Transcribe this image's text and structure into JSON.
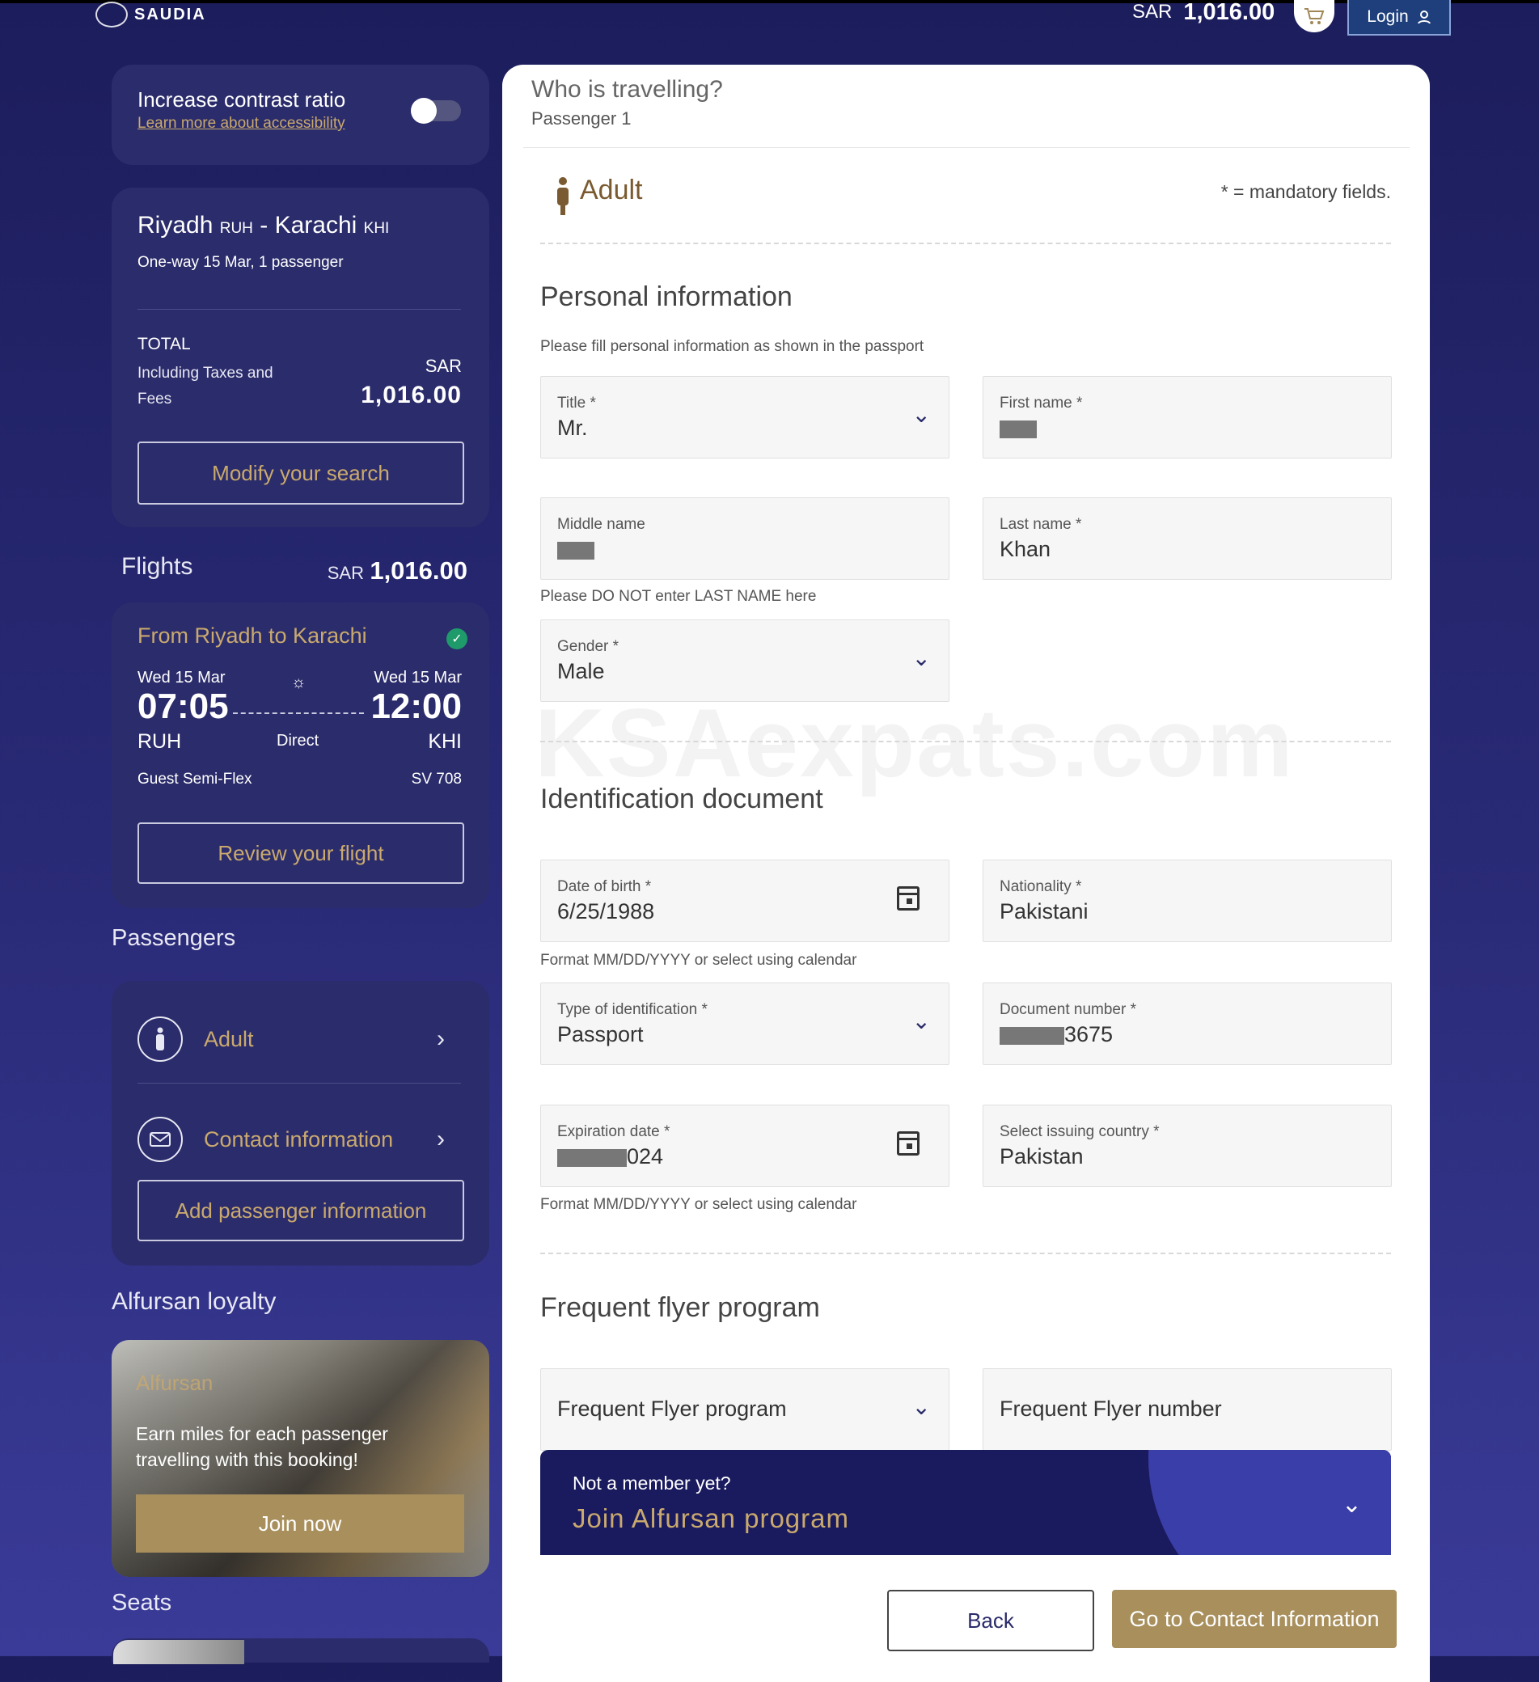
{
  "header": {
    "brand": "SAUDIA",
    "currency": "SAR",
    "total": "1,016.00",
    "cart_icon": "cart-icon",
    "login_label": "Login",
    "login_icon": "user-icon"
  },
  "accessibility": {
    "title": "Increase contrast ratio",
    "link": "Learn more about accessibility",
    "toggle_on": false
  },
  "trip": {
    "origin_city": "Riyadh",
    "origin_code": "RUH",
    "separator": "-",
    "dest_city": "Karachi",
    "dest_code": "KHI",
    "details": "One-way 15 Mar, 1 passenger",
    "total_label": "TOTAL",
    "total_sub": "Including Taxes and Fees",
    "currency": "SAR",
    "total_amount": "1,016.00",
    "modify_label": "Modify your search"
  },
  "flights": {
    "label": "Flights",
    "currency": "SAR",
    "amount": "1,016.00",
    "segment": {
      "title": "From Riyadh to Karachi",
      "dep_date": "Wed 15 Mar",
      "arr_date": "Wed 15 Mar",
      "dep_time": "07:05",
      "arr_time": "12:00",
      "dep_code": "RUH",
      "arr_code": "KHI",
      "stops": "Direct",
      "fare": "Guest Semi-Flex",
      "flight_no": "SV 708",
      "review_label": "Review your flight"
    }
  },
  "passengers": {
    "heading": "Passengers",
    "items": [
      {
        "label": "Adult",
        "icon": "person-icon"
      },
      {
        "label": "Contact information",
        "icon": "envelope-icon"
      }
    ],
    "add_label": "Add passenger information"
  },
  "loyalty": {
    "heading": "Alfursan loyalty",
    "brand": "Alfursan",
    "message": "Earn miles for each passenger travelling with this booking!",
    "join_label": "Join now"
  },
  "seats": {
    "heading": "Seats"
  },
  "form": {
    "title": "Who is travelling?",
    "passenger": "Passenger 1",
    "pax_type": "Adult",
    "mandatory_note": "* = mandatory fields.",
    "personal": {
      "heading": "Personal information",
      "hint": "Please fill personal information as shown in the passport",
      "title_label": "Title *",
      "title_value": "Mr.",
      "first_label": "First name *",
      "middle_label": "Middle name",
      "middle_hint": "Please DO NOT enter LAST NAME here",
      "last_label": "Last name *",
      "last_value": "Khan",
      "gender_label": "Gender *",
      "gender_value": "Male"
    },
    "watermark": "KSAexpats.com",
    "identification": {
      "heading": "Identification document",
      "dob_label": "Date of birth *",
      "dob_value": "6/25/1988",
      "dob_hint": "Format MM/DD/YYYY or select using calendar",
      "nationality_label": "Nationality *",
      "nationality_value": "Pakistani",
      "type_label": "Type of identification *",
      "type_value": "Passport",
      "docnum_label": "Document number *",
      "docnum_suffix": "3675",
      "exp_label": "Expiration date *",
      "exp_suffix": "024",
      "exp_hint": "Format MM/DD/YYYY or select using calendar",
      "country_label": "Select issuing country *",
      "country_value": "Pakistan"
    },
    "ffp": {
      "heading": "Frequent flyer program",
      "program_placeholder": "Frequent Flyer program",
      "number_placeholder": "Frequent Flyer number"
    },
    "member": {
      "question": "Not a member yet?",
      "cta": "Join Alfursan program"
    },
    "back_label": "Back",
    "next_label": "Go to Contact Information"
  }
}
